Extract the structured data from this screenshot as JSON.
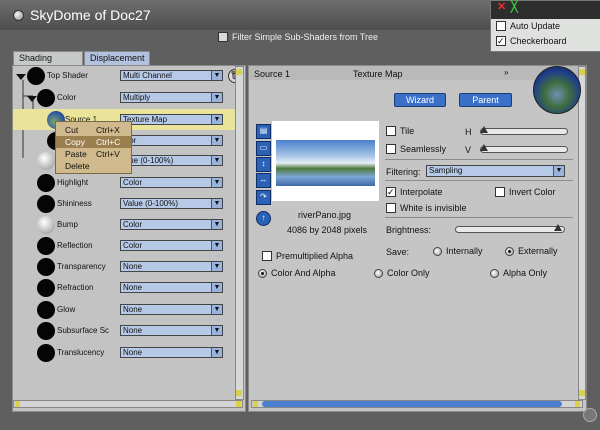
{
  "window": {
    "title": "SkyDome of Doc27"
  },
  "preview_popup": {
    "auto_update": "Auto Update",
    "checkerboard": "Checkerboard"
  },
  "filter": {
    "label": "Filter Simple Sub-Shaders from Tree",
    "checked": false
  },
  "tabs": [
    "Shading",
    "Displacement"
  ],
  "tree": [
    {
      "label": "Top Shader",
      "value": "Multi Channel",
      "ball": "black"
    },
    {
      "label": "Color",
      "value": "Multiply",
      "ball": "black"
    },
    {
      "label": "Source 1",
      "value": "Texture Map",
      "ball": "sky"
    },
    {
      "label": "",
      "value": "olor",
      "ball": "black"
    },
    {
      "label": "",
      "value": "alue (0-100%)",
      "ball": "white"
    },
    {
      "label": "Highlight",
      "value": "Color",
      "ball": "black"
    },
    {
      "label": "Shininess",
      "value": "Value (0-100%)",
      "ball": "black"
    },
    {
      "label": "Bump",
      "value": "Color",
      "ball": "white"
    },
    {
      "label": "Reflection",
      "value": "Color",
      "ball": "black"
    },
    {
      "label": "Transparency",
      "value": "None",
      "ball": "black"
    },
    {
      "label": "Refraction",
      "value": "None",
      "ball": "black"
    },
    {
      "label": "Glow",
      "value": "None",
      "ball": "black"
    },
    {
      "label": "Subsurface Sc",
      "value": "None",
      "ball": "black"
    },
    {
      "label": "Translucency",
      "value": "None",
      "ball": "black"
    }
  ],
  "context_menu": [
    {
      "label": "Cut",
      "shortcut": "Ctrl+X"
    },
    {
      "label": "Copy",
      "shortcut": "Ctrl+C"
    },
    {
      "label": "Paste",
      "shortcut": "Ctrl+V"
    },
    {
      "label": "Delete",
      "shortcut": ""
    }
  ],
  "right_panel": {
    "header_source": "Source 1",
    "header_type": "Texture Map",
    "wizard": "Wizard",
    "parent": "Parent",
    "image_name": "riverPano.jpg",
    "image_size": "4086 by 2048 pixels",
    "premultiplied": "Premultiplied Alpha",
    "alpha_options": [
      "Color And Alpha",
      "Color Only",
      "Alpha Only"
    ],
    "alpha_selected": "Color And Alpha",
    "tile": "Tile",
    "seamlessly": "Seamlessly",
    "h": "H",
    "v": "V",
    "filtering_label": "Filtering:",
    "filtering_value": "Sampling",
    "interpolate": "Interpolate",
    "invert_color": "Invert Color",
    "white_invisible": "White is invisible",
    "brightness": "Brightness:",
    "save_label": "Save:",
    "save_options": [
      "Internally",
      "Externally"
    ],
    "save_selected": "Externally"
  },
  "icons": {
    "menu": "window-menu-icon",
    "trash": "trash-icon",
    "collapse": "double-chevron-down-icon"
  }
}
